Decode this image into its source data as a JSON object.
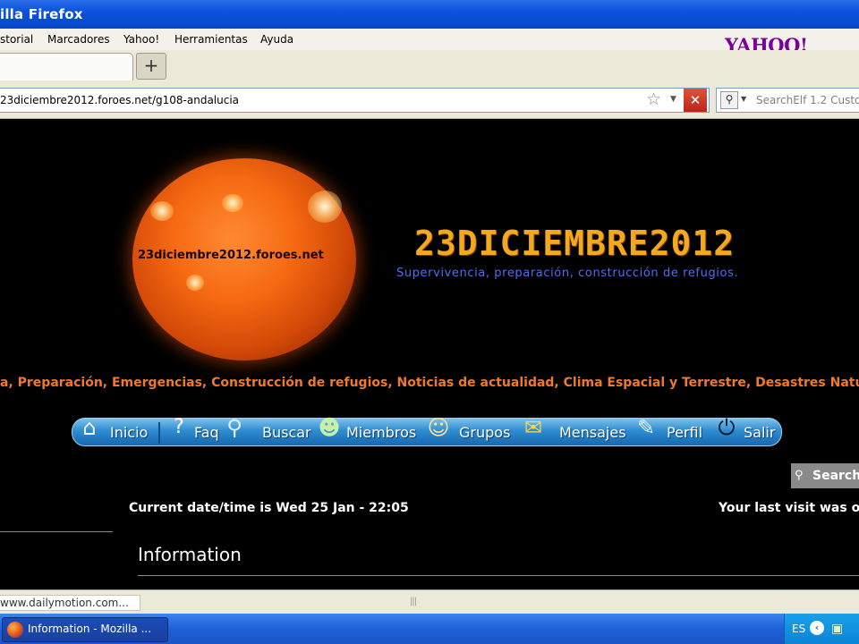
{
  "window": {
    "title": "Mozilla Firefox",
    "title_visible": "illa Firefox"
  },
  "menu": {
    "items": [
      "storial",
      "Marcadores",
      "Yahoo!",
      "Herramientas",
      "Ayuda"
    ]
  },
  "yahoo_logo": "YAHOO!",
  "tabs": {
    "new_tab_symbol": "+"
  },
  "navbar": {
    "url": "23diciembre2012.foroes.net/g108-andalucia",
    "stop_symbol": "✕",
    "search_placeholder": "SearchElf 1.2 Custo"
  },
  "page": {
    "sun_caption": "23diciembre2012.foroes.net",
    "brand": "23DICIEMBRE2012",
    "tagline": "Supervivencia, preparación, construcción de refugios.",
    "ticker": "a, Preparación, Emergencias, Construcción de refugios, Noticias de actualidad, Clima Espacial y Terrestre, Desastres Naturales y mu",
    "nav": [
      {
        "label": "Inicio",
        "icon": "home-icon"
      },
      {
        "label": "Faq",
        "icon": "faq-icon"
      },
      {
        "label": "Buscar",
        "icon": "search-icon"
      },
      {
        "label": "Miembros",
        "icon": "members-icon"
      },
      {
        "label": "Grupos",
        "icon": "groups-icon"
      },
      {
        "label": "Mensajes",
        "icon": "mail-icon"
      },
      {
        "label": "Perfil",
        "icon": "wrench-icon"
      },
      {
        "label": "Salir",
        "icon": "power-icon"
      }
    ],
    "search_button": "Search",
    "datetime": "Current date/time is Wed 25 Jan - 22:05",
    "last_visit": "Your last visit was on",
    "section_heading": "Information"
  },
  "statusbar": {
    "text": "www.dailymotion.com..."
  },
  "taskbar": {
    "task_label": "Information - Mozilla ...",
    "language": "ES"
  },
  "colors": {
    "brand": "#f3a91f",
    "tagline": "#4f6ff0",
    "ticker": "#f07a2c",
    "navpill": "#2e8cd0",
    "xp_blue": "#0a52dd"
  }
}
